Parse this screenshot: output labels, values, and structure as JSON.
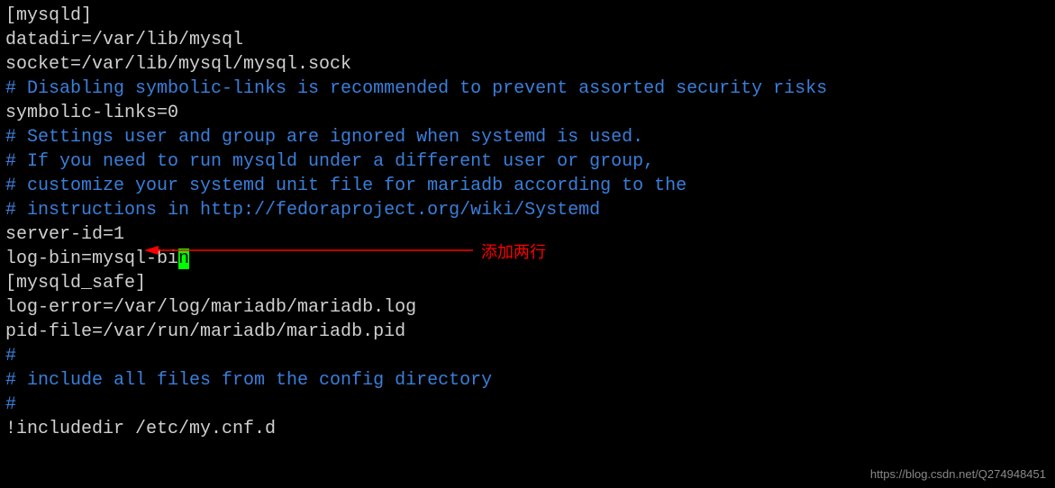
{
  "lines": [
    {
      "text": "[mysqld]",
      "class": "white"
    },
    {
      "text": "datadir=/var/lib/mysql",
      "class": "white"
    },
    {
      "text": "socket=/var/lib/mysql/mysql.sock",
      "class": "white"
    },
    {
      "text": "# Disabling symbolic-links is recommended to prevent assorted security risks",
      "class": "blue"
    },
    {
      "text": "symbolic-links=0",
      "class": "white"
    },
    {
      "text": "# Settings user and group are ignored when systemd is used.",
      "class": "blue"
    },
    {
      "text": "# If you need to run mysqld under a different user or group,",
      "class": "blue"
    },
    {
      "text": "# customize your systemd unit file for mariadb according to the",
      "class": "blue"
    },
    {
      "text": "# instructions in http://fedoraproject.org/wiki/Systemd",
      "class": "blue"
    },
    {
      "text": "server-id=1",
      "class": "white"
    },
    {
      "text": "log-bin=mysql-bi",
      "class": "white",
      "cursor": "n"
    },
    {
      "text": "[mysqld_safe]",
      "class": "white"
    },
    {
      "text": "log-error=/var/log/mariadb/mariadb.log",
      "class": "white"
    },
    {
      "text": "pid-file=/var/run/mariadb/mariadb.pid",
      "class": "white"
    },
    {
      "text": "",
      "class": "white"
    },
    {
      "text": "#",
      "class": "blue"
    },
    {
      "text": "# include all files from the config directory",
      "class": "blue"
    },
    {
      "text": "#",
      "class": "blue"
    },
    {
      "text": "!includedir /etc/my.cnf.d",
      "class": "white"
    }
  ],
  "annotation_text": "添加两行",
  "watermark": "https://blog.csdn.net/Q274948451"
}
